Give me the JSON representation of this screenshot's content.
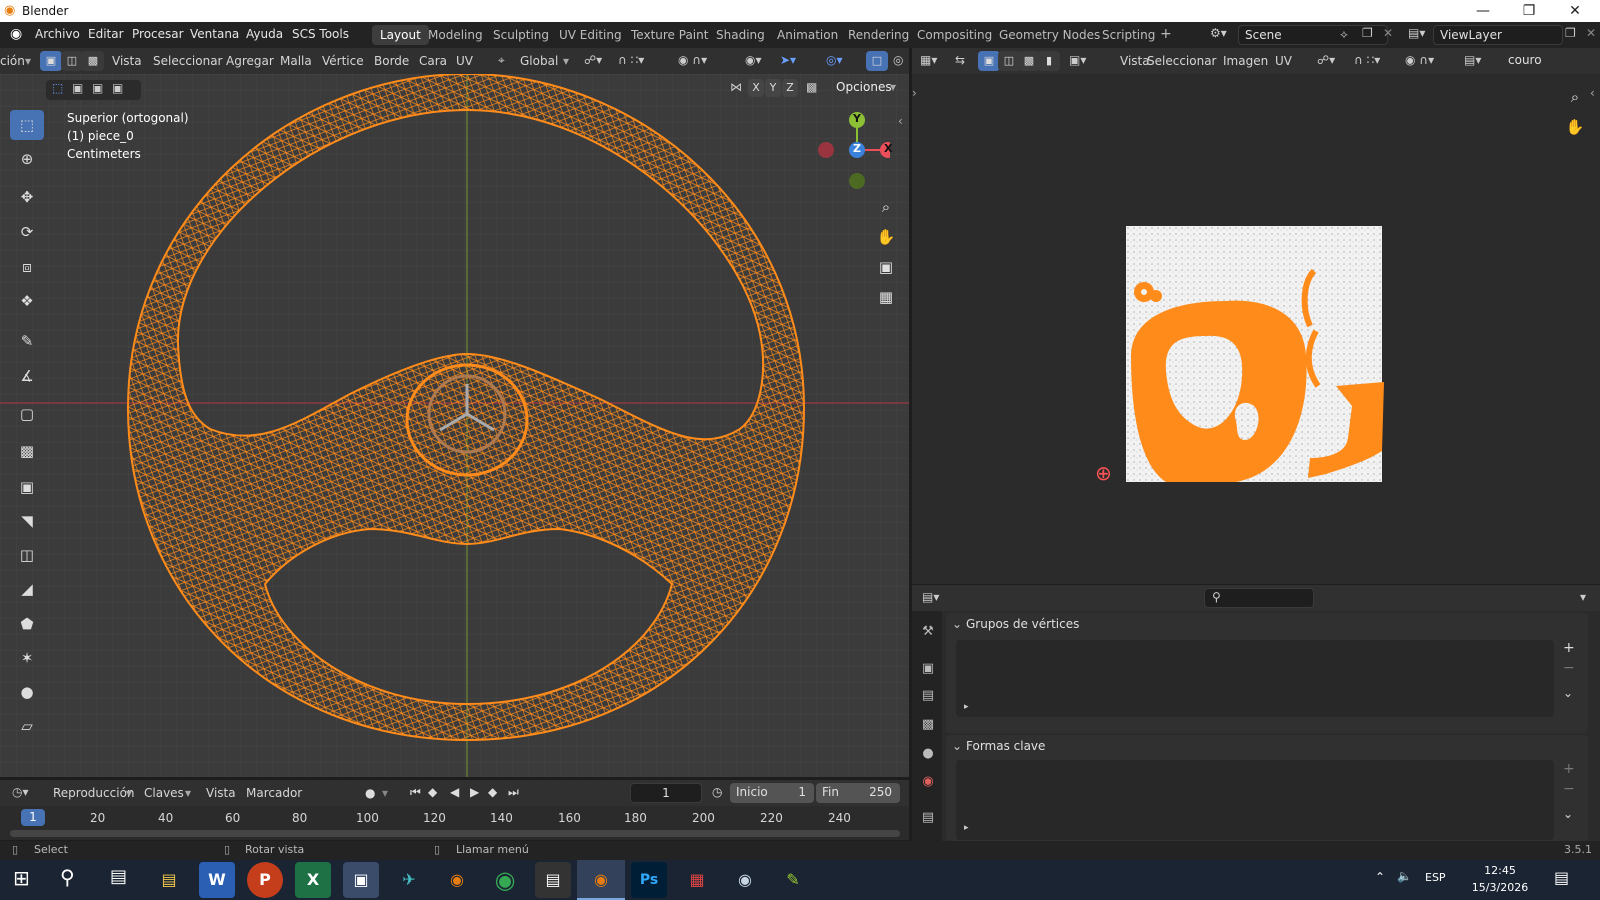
{
  "window": {
    "title": "Blender"
  },
  "menus": [
    "Archivo",
    "Editar",
    "Procesar",
    "Ventana",
    "Ayuda",
    "SCS Tools"
  ],
  "workspaces": [
    {
      "label": "Layout",
      "active": true
    },
    {
      "label": "Modeling"
    },
    {
      "label": "Sculpting"
    },
    {
      "label": "UV Editing"
    },
    {
      "label": "Texture Paint"
    },
    {
      "label": "Shading"
    },
    {
      "label": "Animation"
    },
    {
      "label": "Rendering"
    },
    {
      "label": "Compositing"
    },
    {
      "label": "Geometry Nodes"
    },
    {
      "label": "Scripting"
    }
  ],
  "scene": {
    "name": "Scene",
    "view_layer": "ViewLayer"
  },
  "viewport": {
    "mode_label": "ción",
    "header_menus": [
      "Vista",
      "Seleccionar",
      "Agregar",
      "Malla",
      "Vértice",
      "Borde",
      "Cara",
      "UV"
    ],
    "orientation": "Global",
    "axes": [
      "X",
      "Y",
      "Z"
    ],
    "options_label": "Opciones",
    "overlay_text": [
      "Superior (ortogonal)",
      "(1) piece_0",
      "Centimeters"
    ],
    "gizmo": {
      "y": "Y",
      "z": "Z",
      "x": "X"
    }
  },
  "uv_editor": {
    "menus": [
      "Vista",
      "Seleccionar",
      "Imagen",
      "UV"
    ],
    "image_name": "couro"
  },
  "properties": {
    "sections": [
      {
        "title": "Grupos de vértices"
      },
      {
        "title": "Formas clave"
      }
    ]
  },
  "timeline": {
    "menus": [
      "Reproducción",
      "Claves",
      "Vista",
      "Marcador"
    ],
    "current_frame": "1",
    "start_label": "Inicio",
    "start": "1",
    "end_label": "Fin",
    "end": "250",
    "ruler": [
      "1",
      "20",
      "40",
      "60",
      "80",
      "100",
      "120",
      "140",
      "160",
      "180",
      "200",
      "220",
      "240"
    ]
  },
  "statusbar": {
    "items": [
      "Select",
      "Rotar vista",
      "Llamar menú"
    ],
    "version": "3.5.1"
  },
  "taskbar": {
    "lang": "ESP",
    "time": "12:45",
    "date": "15/3/2026"
  },
  "colors": {
    "mesh": "#ff8c1a",
    "accent": "#4772b3",
    "bg": "#3a3a3a"
  }
}
